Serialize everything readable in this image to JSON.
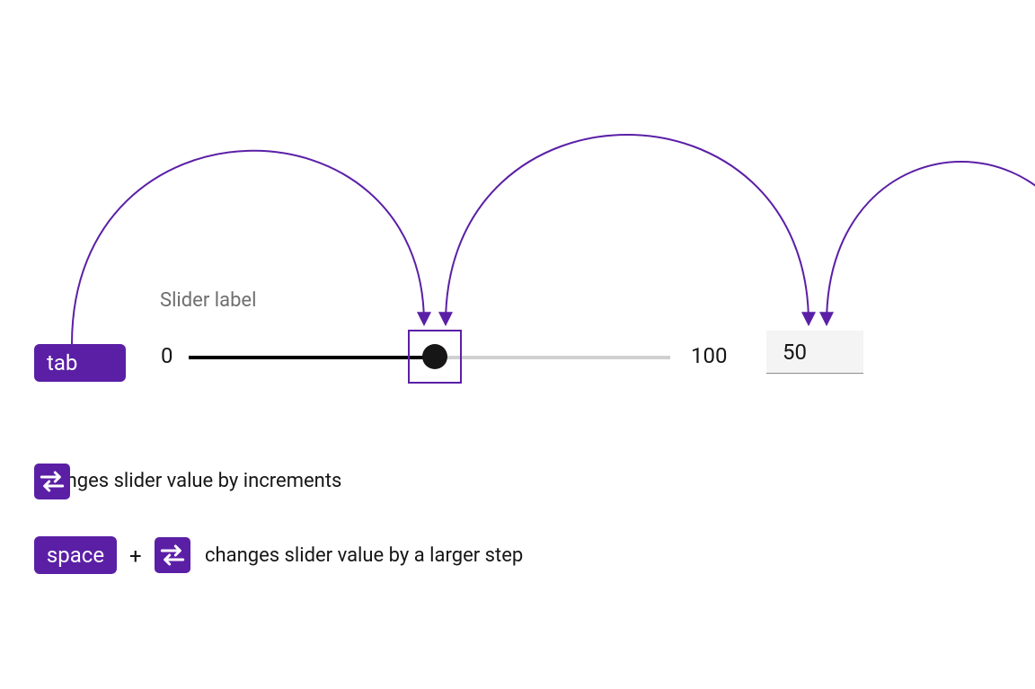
{
  "slider": {
    "label": "Slider label",
    "min": "0",
    "max": "100",
    "value": "50"
  },
  "keys": {
    "tab": "tab",
    "space": "space",
    "plus": "+"
  },
  "legend": {
    "row1": "changes slider value by increments",
    "row2": "changes slider value by a larger step"
  },
  "style": {
    "accent": "#5b1fa6"
  }
}
